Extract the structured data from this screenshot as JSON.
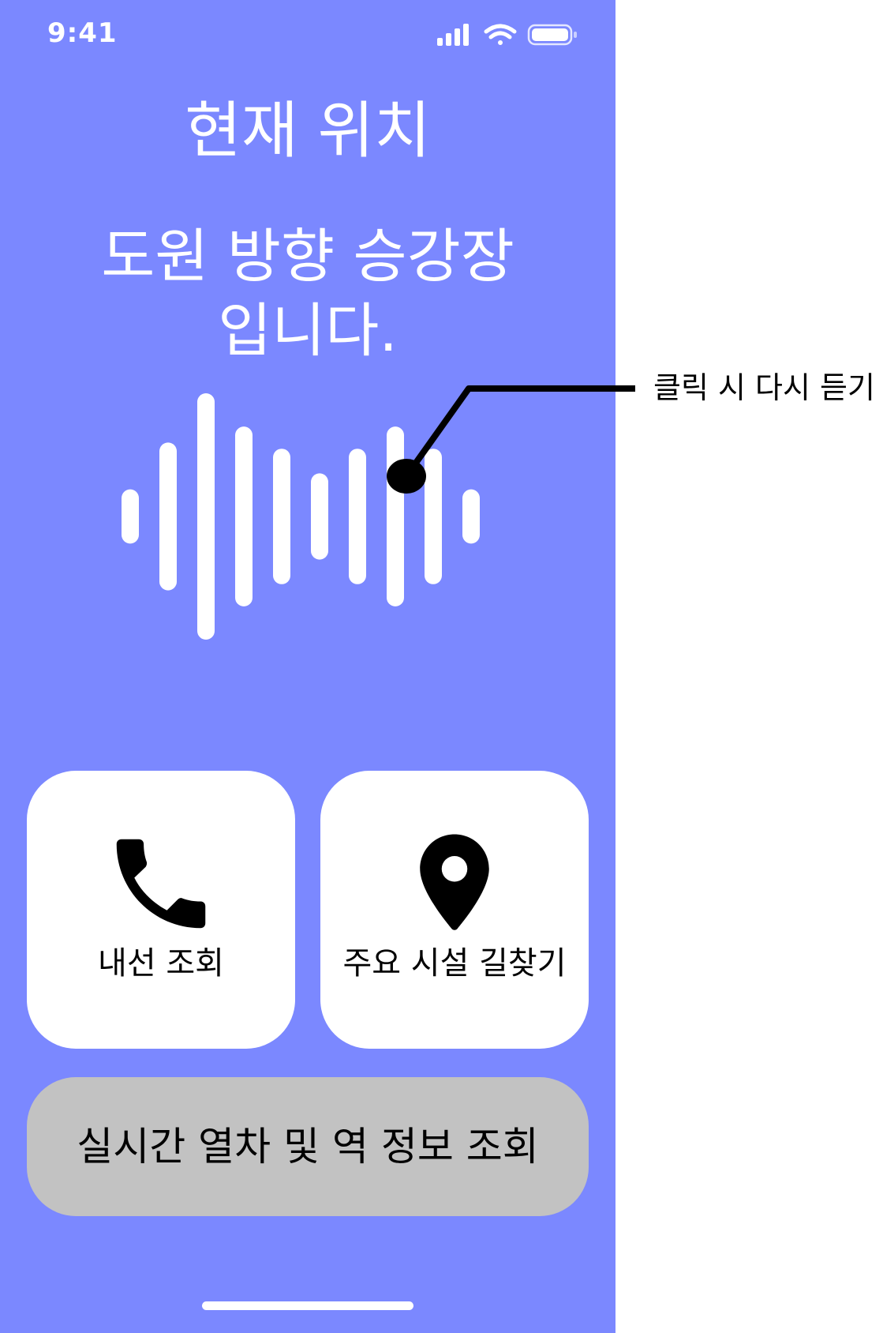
{
  "status_bar": {
    "time": "9:41",
    "icons": [
      "signal-icon",
      "wifi-icon",
      "battery-icon"
    ]
  },
  "header": {
    "title": "현재 위치",
    "location_message": "도원 방향 승강장\n입니다."
  },
  "waveform": {
    "icon": "audio-waveform-icon",
    "bar_levels": [
      0.22,
      0.6,
      1.0,
      0.73,
      0.55,
      0.35,
      0.55,
      0.73,
      0.55,
      0.22
    ]
  },
  "cards": [
    {
      "label": "내선 조회",
      "icon": "phone-icon"
    },
    {
      "label": "주요 시설 길찾기",
      "icon": "map-pin-icon"
    }
  ],
  "bottom_button": {
    "label": "실시간 열차 및 역 정보 조회"
  },
  "annotation": {
    "text": "클릭 시 다시 듣기"
  },
  "colors": {
    "background": "#7b88ff",
    "card": "#ffffff",
    "bottom_button": "#c2c2c2",
    "text_on_bg": "#ffffff"
  }
}
